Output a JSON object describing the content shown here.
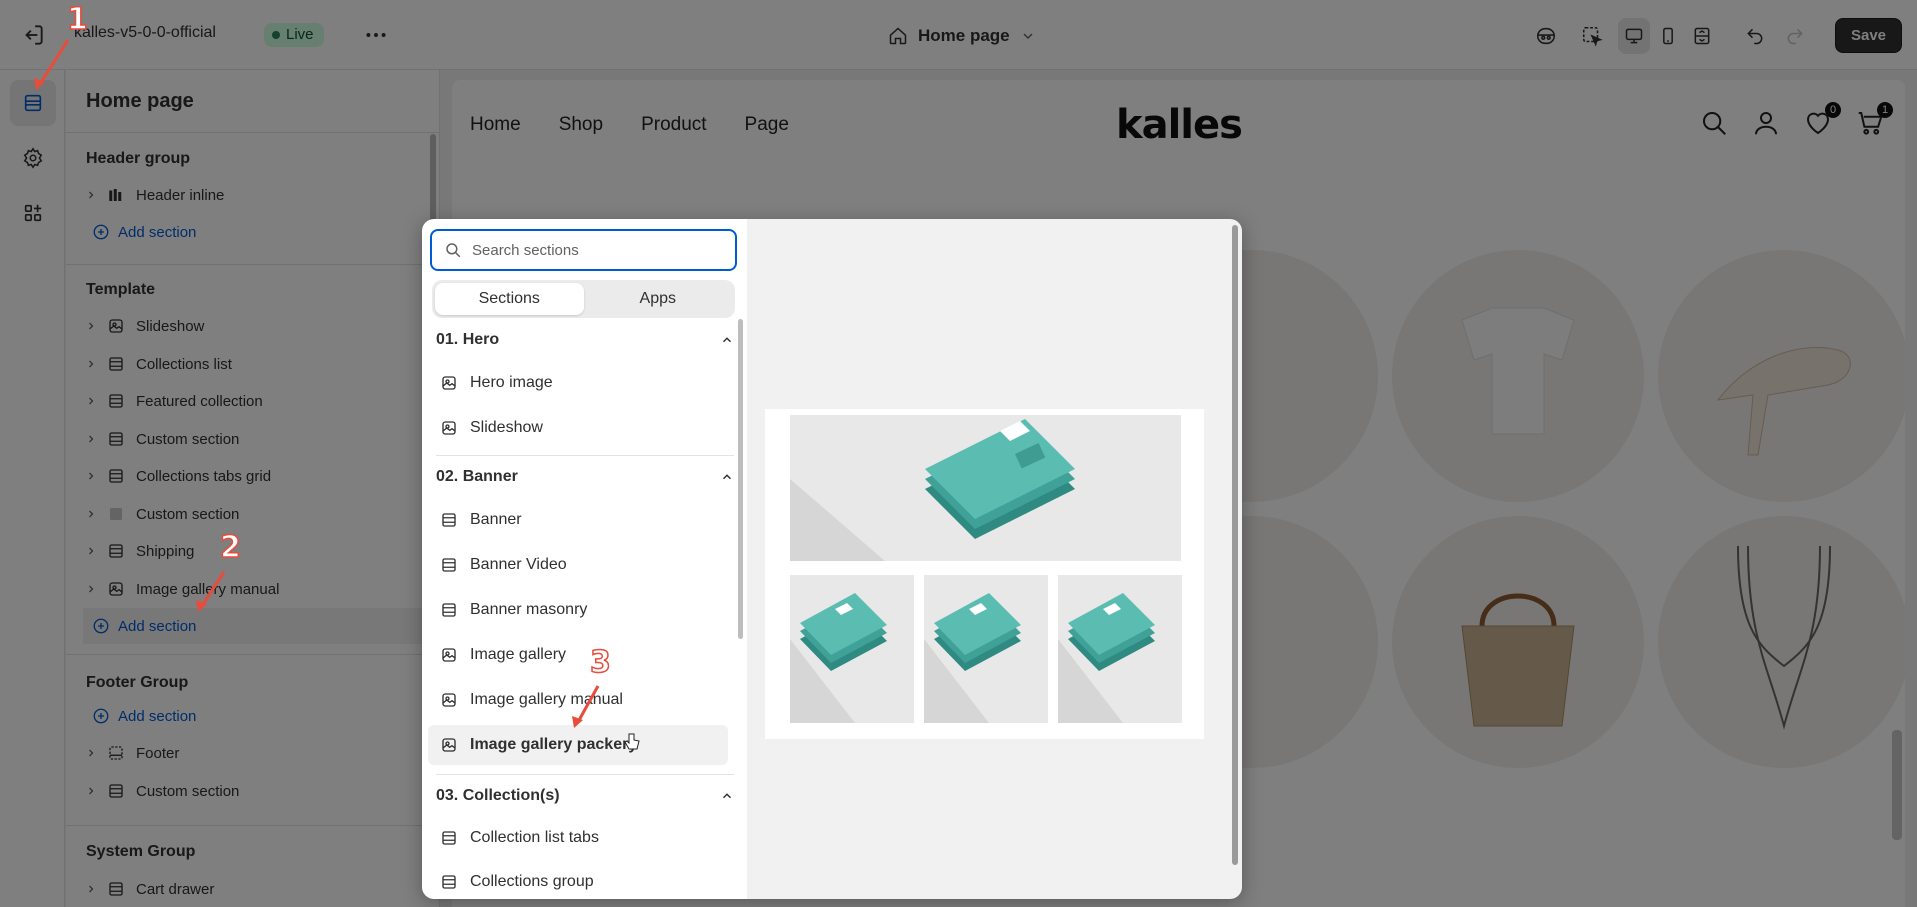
{
  "topbar": {
    "store_name": "kalles-v5-0-0-official",
    "live_label": "Live",
    "page_selector": "Home page",
    "save_label": "Save"
  },
  "panel": {
    "title": "Home page",
    "groups": [
      {
        "label": "Header group",
        "items": [
          {
            "label": "Header inline",
            "icon": "header-icon"
          }
        ],
        "add_label": "Add section"
      },
      {
        "label": "Template",
        "items": [
          {
            "label": "Slideshow",
            "icon": "slideshow-icon"
          },
          {
            "label": "Collections list",
            "icon": "section-icon"
          },
          {
            "label": "Featured collection",
            "icon": "section-icon"
          },
          {
            "label": "Custom section",
            "icon": "section-icon"
          },
          {
            "label": "Collections tabs grid",
            "icon": "section-icon"
          },
          {
            "label": "Custom section",
            "icon": "square-icon"
          },
          {
            "label": "Shipping",
            "icon": "section-icon"
          },
          {
            "label": "Image gallery manual",
            "icon": "image-icon"
          }
        ],
        "add_label": "Add section"
      },
      {
        "label": "Footer Group",
        "add_label": "Add section",
        "items": [
          {
            "label": "Footer",
            "icon": "footer-icon"
          },
          {
            "label": "Custom section",
            "icon": "section-icon"
          }
        ]
      },
      {
        "label": "System Group",
        "items": [
          {
            "label": "Cart drawer",
            "icon": "section-icon"
          }
        ]
      }
    ]
  },
  "picker": {
    "search_placeholder": "Search sections",
    "tabs": [
      "Sections",
      "Apps"
    ],
    "categories": [
      {
        "label": "01. Hero",
        "items": [
          "Hero image",
          "Slideshow"
        ]
      },
      {
        "label": "02. Banner",
        "items": [
          "Banner",
          "Banner Video",
          "Banner masonry",
          "Image gallery",
          "Image gallery manual",
          "Image gallery packery"
        ]
      },
      {
        "label": "03. Collection(s)",
        "items": [
          "Collection list tabs",
          "Collections group"
        ]
      }
    ],
    "selected": "Image gallery packery"
  },
  "preview": {
    "nav_links": [
      "Home",
      "Shop",
      "Product",
      "Page"
    ],
    "logo": "kalles",
    "wishlist_count": "0",
    "cart_count": "1"
  },
  "annotations": [
    "1",
    "2",
    "3"
  ],
  "colors": {
    "accent": "#005bd3",
    "live_bg": "#cdfee1",
    "annotation": "#e74c3c",
    "thumb_teal": "#4fb3a9"
  }
}
